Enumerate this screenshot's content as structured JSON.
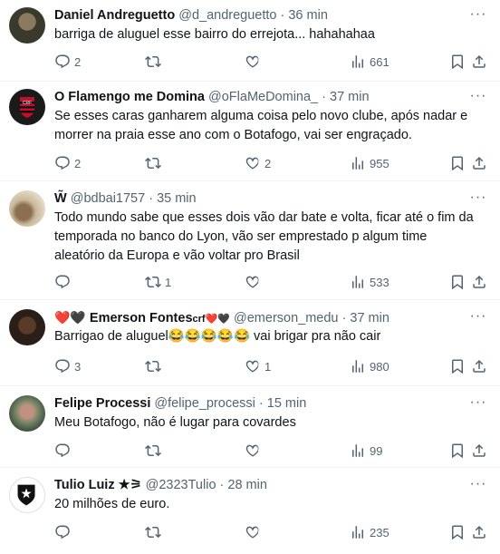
{
  "tweets": [
    {
      "name": "Daniel Andreguetto",
      "handle": "@d_andreguetto",
      "time": "· 36 min",
      "text": "barriga de aluguel esse bairro do errejota... hahahahaa",
      "replies": "2",
      "retweets": "",
      "likes": "",
      "views": "661",
      "avatar_color": "#4a4a3a"
    },
    {
      "name": "O Flamengo me Domina",
      "handle": "@oFlaMeDomina_",
      "time": "· 37 min",
      "text": "Se esses caras ganharem alguma coisa pelo novo clube, após nadar e morrer na praia esse ano com o Botafogo, vai ser engraçado.",
      "replies": "2",
      "retweets": "",
      "likes": "2",
      "views": "955",
      "avatar_color": "#1a1a1a"
    },
    {
      "name": "W̃",
      "handle": "@bdbai1757",
      "time": "· 35 min",
      "text": "Todo mundo sabe que esses dois vão dar bate e volta, ficar até o fim da temporada no banco do Lyon, vão ser emprestado p algum time aleatório da Europa e vão voltar pro Brasil",
      "replies": "",
      "retweets": "1",
      "likes": "",
      "views": "533",
      "avatar_color": "#b8a88a"
    },
    {
      "name_prefix": "❤️🖤",
      "name": "Emerson Fontes",
      "name_suffix": "crf❤️🖤",
      "handle": "@emerson_medu",
      "time": "· 37 min",
      "text": "Barrigao de aluguel😂😂😂😂😂 vai brigar pra não cair",
      "replies": "3",
      "retweets": "",
      "likes": "1",
      "views": "980",
      "avatar_color": "#3a2a20"
    },
    {
      "name": "Felipe Processi",
      "handle": "@felipe_processi",
      "time": "· 15 min",
      "text": "Meu Botafogo, não é lugar para covardes",
      "replies": "",
      "retweets": "",
      "likes": "",
      "views": "99",
      "avatar_color": "#6a7a5a"
    },
    {
      "name": "Tulio Luiz ★⚞",
      "handle": "@2323Tulio",
      "time": "· 28 min",
      "text": "20 milhões de euro.",
      "replies": "",
      "retweets": "",
      "likes": "",
      "views": "235",
      "avatar_color": "#111111"
    }
  ],
  "icons": {
    "reply": "reply-icon",
    "retweet": "retweet-icon",
    "like": "heart-icon",
    "views": "views-icon",
    "bookmark": "bookmark-icon",
    "share": "share-icon",
    "more": "more-icon"
  },
  "colors": {
    "muted": "#536471",
    "text": "#0f1419",
    "divider": "#eff3f4"
  }
}
